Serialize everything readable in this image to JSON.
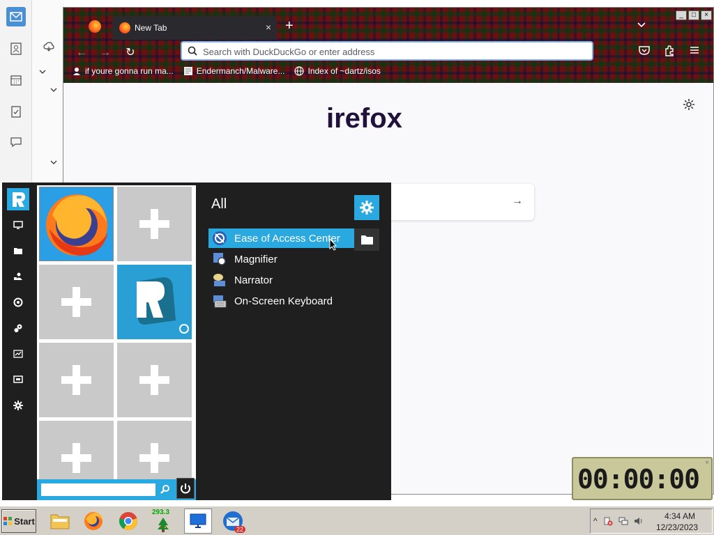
{
  "firefox": {
    "tab_title": "New Tab",
    "tab_close": "×",
    "new_tab": "+",
    "url_placeholder": "Search with DuckDuckGo or enter address",
    "nav_back": "←",
    "nav_forward": "→",
    "reload": "↻",
    "tab_list": "⌄",
    "window_controls": [
      "_",
      "□",
      "×"
    ],
    "bookmarks": [
      {
        "label": "if youre gonna run ma...",
        "icon": "user-hat-icon"
      },
      {
        "label": "Endermanch/Malware...",
        "icon": "page-icon"
      },
      {
        "label": "Index of ~dartz/isos",
        "icon": "globe-icon"
      }
    ],
    "brand_text": "irefox",
    "card_arrow": "→"
  },
  "start_menu": {
    "category": "All",
    "search_placeholder": "",
    "apps": [
      {
        "label": "Ease of Access Center",
        "selected": true,
        "icon": "ease-of-access-icon"
      },
      {
        "label": "Magnifier",
        "selected": false,
        "icon": "magnifier-icon"
      },
      {
        "label": "Narrator",
        "selected": false,
        "icon": "narrator-icon"
      },
      {
        "label": "On-Screen Keyboard",
        "selected": false,
        "icon": "keyboard-icon"
      }
    ],
    "rail_icons": [
      "monitor-icon",
      "folder-icon",
      "users-icon",
      "network-icon",
      "gears-icon",
      "chart-icon",
      "display-icon",
      "settings-icon"
    ],
    "tiles": [
      "firefox-tile",
      "add-tile",
      "add-tile",
      "rk-launcher-tile",
      "add-tile",
      "add-tile",
      "add-tile",
      "add-tile"
    ]
  },
  "timer": {
    "value": "00:00:00",
    "close": "×"
  },
  "taskbar": {
    "start_label": "Start",
    "tree_counter": "293.3",
    "mail_badge": "22",
    "tray_chevron": "^",
    "clock_time": "4:34 AM",
    "clock_date": "12/23/2023"
  },
  "colors": {
    "accent": "#2aa8e0",
    "menu_bg": "#1f1f1f",
    "tile_gray": "#c9c9c9",
    "taskbar": "#d4d0c8"
  }
}
